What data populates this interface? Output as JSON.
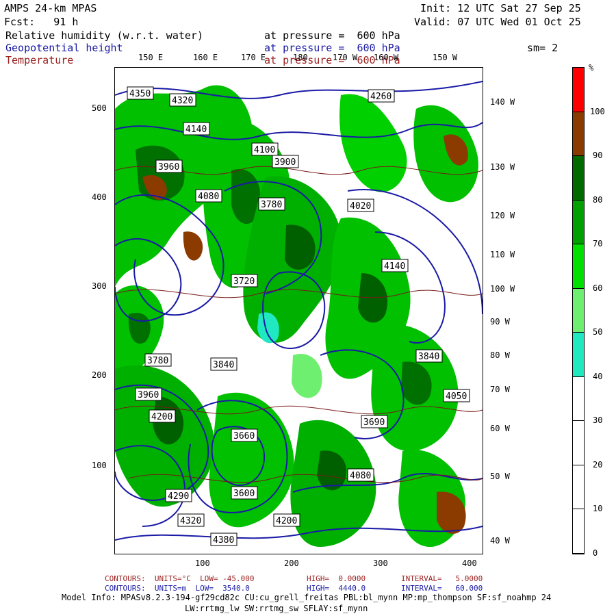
{
  "header": {
    "model": "AMPS 24-km MPAS",
    "init": "Init: 12 UTC Sat 27 Sep 25",
    "fcst": "Fcst:   91 h",
    "valid": "Valid: 07 UTC Wed 01 Oct 25",
    "fields": [
      {
        "name": "Relative humidity (w.r.t. water)",
        "level": "at pressure =  600 hPa"
      },
      {
        "name": "Geopotential height",
        "level": "at pressure =  600 hPa"
      },
      {
        "name": "Temperature",
        "level": "at pressure =  600 hPa"
      }
    ],
    "smoothing": "sm= 2"
  },
  "map": {
    "top_lon_labels": [
      "150 E",
      "160 E",
      "170 E",
      "180",
      "170 W",
      "160 W",
      "150 W"
    ],
    "right_lon_labels": [
      "140 W",
      "130 W",
      "120 W",
      "110 W",
      "100 W",
      "90 W",
      "80 W",
      "70 W",
      "60 W",
      "50 W",
      "40 W"
    ],
    "left_y_ticks": [
      "500",
      "400",
      "300",
      "200",
      "100"
    ],
    "bottom_x_ticks": [
      "100",
      "200",
      "300",
      "400"
    ],
    "height_labels": [
      "4350",
      "4320",
      "4140",
      "4100",
      "3960",
      "4080",
      "3780",
      "4020",
      "3900",
      "3720",
      "4200",
      "3840",
      "4140",
      "3960",
      "3660",
      "3600",
      "4050",
      "3690",
      "4080",
      "4200",
      "4320",
      "4380",
      "3780",
      "3840",
      "4260",
      "4290"
    ]
  },
  "colorbar": {
    "unit": "%",
    "labels": [
      "100",
      "90",
      "80",
      "70",
      "60",
      "50",
      "40",
      "30",
      "20",
      "10",
      "0"
    ],
    "colors": [
      "#ff0000",
      "#8b3a00",
      "#006a00",
      "#00a000",
      "#00e000",
      "#6fef6f",
      "#20e8c0",
      "#ffffff",
      "#ffffff",
      "#ffffff",
      "#ffffff"
    ]
  },
  "footer": {
    "line1_label": "CONTOURS:  UNITS=°C  LOW= -45.000",
    "line1_high": "HIGH=  0.0000",
    "line1_int": "INTERVAL=   5.0000",
    "line2_label": "CONTOURS:  UNITS=m  LOW=  3540.0",
    "line2_high": "HIGH=  4440.0",
    "line2_int": "INTERVAL=   60.000",
    "model_info": "Model Info: MPASv8.2.3-194-gf29cd82c CU:cu_grell_freitas PBL:bl_mynn MP:mp_thompson SF:sf_noahmp 24",
    "model_info2": "LW:rrtmg_lw SW:rrtmg_sw SFLAY:sf_mynn"
  }
}
